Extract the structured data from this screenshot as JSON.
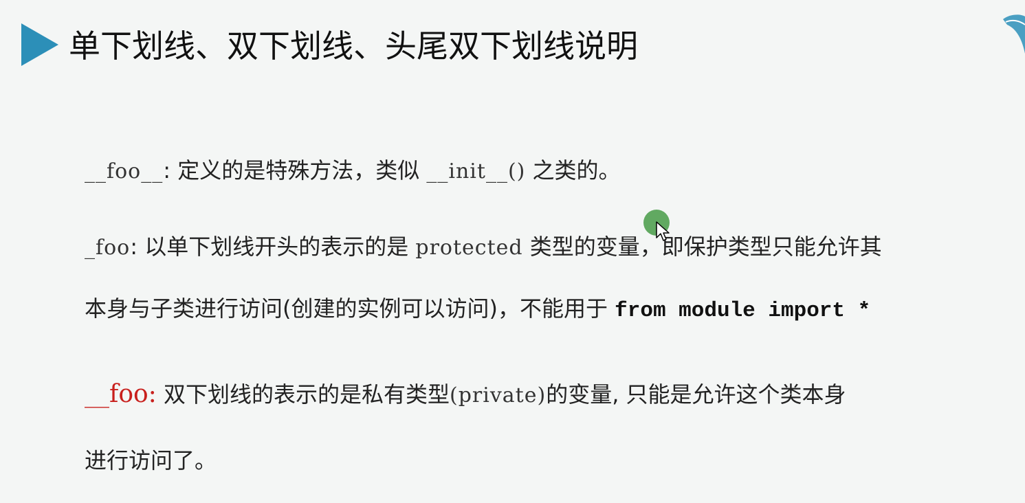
{
  "slide": {
    "title": "单下划线、双下划线、头尾双下划线说明",
    "accent_color": "#2c8fb8",
    "highlight_color": "#c8201d",
    "line1": {
      "code": "__foo__",
      "text": ": 定义的是特殊方法，类似 ",
      "code2": "__init__()",
      "text2": " 之类的。"
    },
    "line2": {
      "code": "_foo",
      "text": ": 以单下划线开头的表示的是 ",
      "code2": "protected",
      "text2": " 类型的变量，即保护类型只能允许其"
    },
    "line3": {
      "text": "本身与子类进行访问(创建的实例可以访问)，不能用于 ",
      "code": "from module import *"
    },
    "line4": {
      "code": "__foo:",
      "text": " 双下划线的表示的是私有类型",
      "code2": "(private)",
      "text2": "的变量, 只能是允许这个类本身"
    },
    "line5": {
      "text": "进行访问了。"
    }
  },
  "icons": {
    "title_marker": "play-triangle-icon",
    "cursor": "mouse-pointer-icon"
  }
}
